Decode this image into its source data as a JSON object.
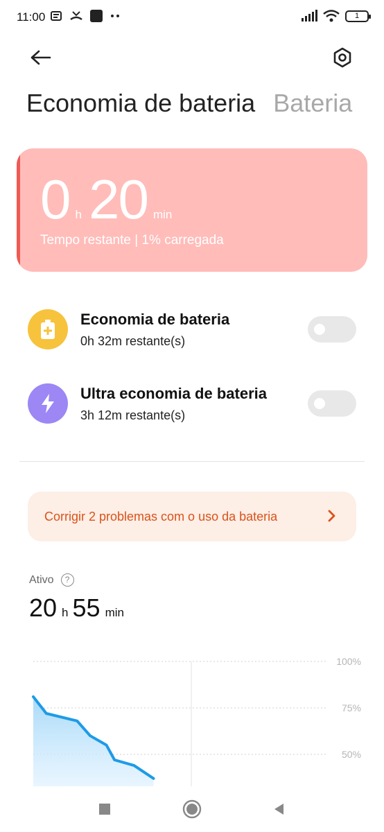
{
  "status_bar": {
    "time": "11:00",
    "battery_level": "1",
    "icons": [
      "message-icon",
      "missed-call-icon",
      "app-icon",
      "more-dots-icon",
      "signal-icon",
      "wifi-icon",
      "battery-icon"
    ]
  },
  "header": {
    "back_icon": "arrow-left-icon",
    "settings_icon": "settings-icon"
  },
  "tabs": [
    {
      "label": "Economia de bateria",
      "active": true
    },
    {
      "label": "Bateria",
      "active": false
    }
  ],
  "hero": {
    "hours": "0",
    "hours_unit": "h",
    "minutes": "20",
    "minutes_unit": "min",
    "subtitle": "Tempo restante | 1% carregada",
    "color": "#ffbcb9"
  },
  "modes": [
    {
      "title": "Economia de bateria",
      "subtitle": "0h 32m restante(s)",
      "icon": "battery-plus-icon",
      "color": "#f7c33c",
      "enabled": false
    },
    {
      "title": "Ultra economia de bateria",
      "subtitle": "3h 12m restante(s)",
      "icon": "lightning-icon",
      "color": "#9c87f5",
      "enabled": false
    }
  ],
  "issues": {
    "text": "Corrigir 2 problemas com o uso da bateria",
    "color": "#d9531a"
  },
  "active": {
    "label": "Ativo",
    "hours": "20",
    "hours_unit": "h",
    "minutes": "55",
    "minutes_unit": "min"
  },
  "chart_data": {
    "type": "area",
    "y_ticks": [
      "100%",
      "75%",
      "50%"
    ],
    "ylim": [
      0,
      100
    ],
    "points": [
      [
        0,
        81
      ],
      [
        8,
        72
      ],
      [
        27,
        68
      ],
      [
        35,
        60
      ],
      [
        45,
        55
      ],
      [
        50,
        47
      ],
      [
        62,
        44
      ],
      [
        74,
        37
      ]
    ],
    "xlim": [
      0,
      180
    ],
    "color": "#1e9be6"
  },
  "nav": {
    "icons": [
      "recent-apps-icon",
      "home-icon",
      "back-icon"
    ]
  }
}
